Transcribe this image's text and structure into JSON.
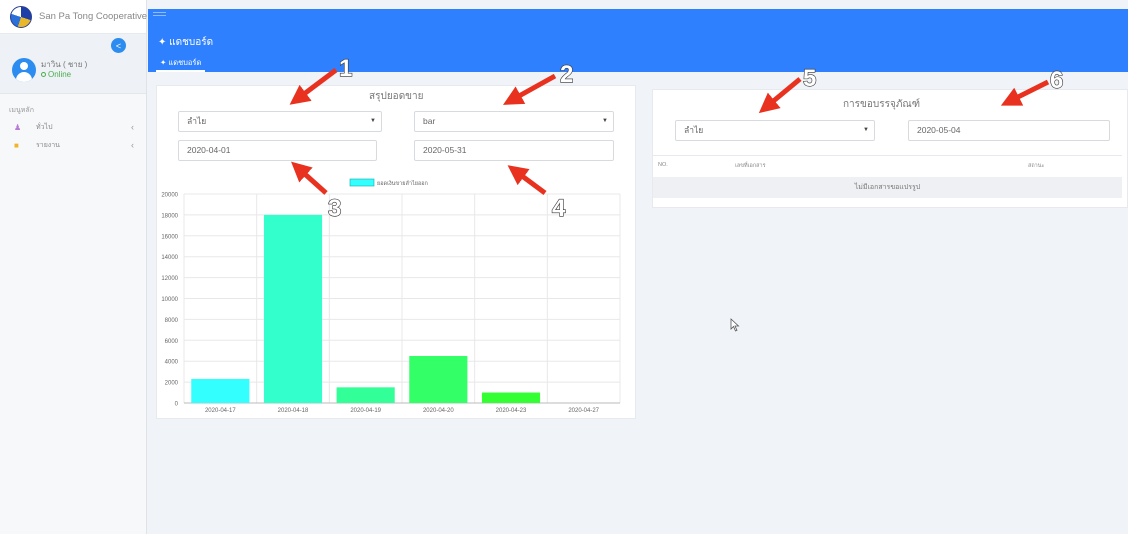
{
  "sidebar": {
    "brand": "San Pa Tong Cooperative",
    "user_name": "มาวิน ( ชาย )",
    "user_status": "Online",
    "menu_heading": "เมนูหลัก",
    "items": [
      {
        "label": "ทั่วไป",
        "icon": "users-icon",
        "color": "#b57bd6"
      },
      {
        "label": "รายงาน",
        "icon": "folder-icon",
        "color": "#f0b429"
      }
    ]
  },
  "header": {
    "title": "แดชบอร์ด",
    "tab": "แดชบอร์ด",
    "color": "#2f80ff"
  },
  "sales_card": {
    "title": "สรุปยอดขาย",
    "product_select": "ลำไย",
    "chart_type_select": "bar",
    "start_date": "2020-04-01",
    "end_date": "2020-05-31"
  },
  "packaging_card": {
    "title": "การขอบรรจุภัณฑ์",
    "product_select": "ลำไย",
    "date": "2020-05-04",
    "columns": [
      "NO.",
      "เลขที่เอกสาร",
      "สถานะ"
    ],
    "empty_text": "ไม่มีเอกสารขอแปรรูป"
  },
  "annotations": [
    "1",
    "2",
    "3",
    "4",
    "5",
    "6"
  ],
  "chart_data": {
    "type": "bar",
    "categories": [
      "2020-04-17",
      "2020-04-18",
      "2020-04-19",
      "2020-04-20",
      "2020-04-23",
      "2020-04-27"
    ],
    "series": [
      {
        "name": "ยอดเงินขายลำไยออก",
        "values": [
          2300,
          18000,
          1500,
          4500,
          1000,
          0
        ]
      }
    ],
    "colors": [
      "#33ffff",
      "#33ffcc",
      "#33ff99",
      "#33ff66",
      "#33ff33",
      "#33ff33"
    ],
    "yticks": [
      "0",
      "2000",
      "4000",
      "6000",
      "8000",
      "10000",
      "12000",
      "14000",
      "16000",
      "18000",
      "20000"
    ],
    "ylim": [
      0,
      20000
    ],
    "grid": true,
    "legend": "top-center"
  }
}
